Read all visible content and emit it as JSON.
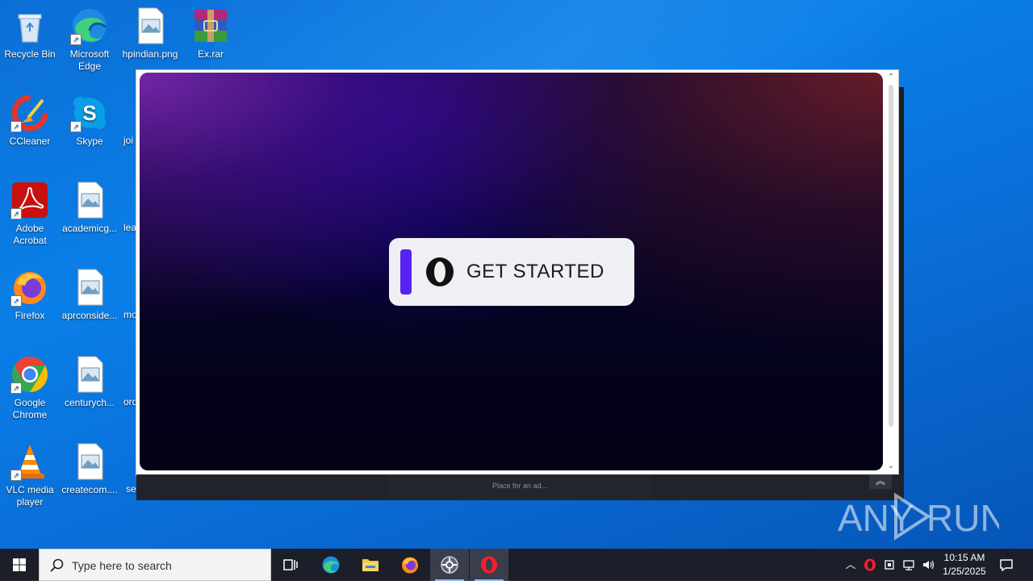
{
  "desktop": {
    "icons": [
      {
        "label": "Recycle Bin"
      },
      {
        "label": "Microsoft Edge"
      },
      {
        "label": "hpindian.png"
      },
      {
        "label": "Ex.rar"
      },
      {
        "label": "CCleaner"
      },
      {
        "label": "Skype"
      },
      {
        "label": "Adobe Acrobat"
      },
      {
        "label": "academicg..."
      },
      {
        "label": "Firefox"
      },
      {
        "label": "aprconside..."
      },
      {
        "label": "Google Chrome"
      },
      {
        "label": "centurych..."
      },
      {
        "label": "VLC media player"
      },
      {
        "label": "createcom...."
      }
    ],
    "partial_labels": [
      "joi",
      "lea",
      "mo",
      "ord",
      "sex"
    ]
  },
  "window": {
    "cta_label": "GET STARTED",
    "accent_color": "#5a22f0",
    "ad_placeholder": "Place for an ad...",
    "collapse_icon": "double-chevron-up-icon"
  },
  "watermark": {
    "text": "ANY RUN"
  },
  "taskbar": {
    "search_placeholder": "Type here to search",
    "apps": [
      "task-view",
      "microsoft-edge",
      "file-explorer",
      "firefox",
      "opera-installer",
      "opera"
    ],
    "clock_time": "10:15 AM",
    "clock_date": "1/25/2025"
  }
}
